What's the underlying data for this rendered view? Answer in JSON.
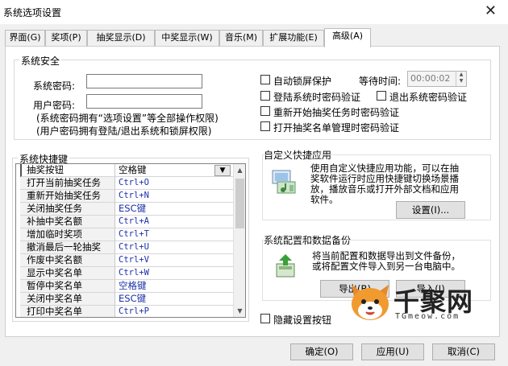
{
  "window": {
    "title": "系统选项设置"
  },
  "tabs": [
    {
      "label": "界面(G)"
    },
    {
      "label": "奖项(P)"
    },
    {
      "label": "抽奖显示(D)"
    },
    {
      "label": "中奖显示(W)"
    },
    {
      "label": "音乐(M)"
    },
    {
      "label": "扩展功能(E)"
    },
    {
      "label": "高级(A)",
      "active": true
    }
  ],
  "security": {
    "title": "系统安全",
    "system_password_label": "系统密码:",
    "system_password_value": "",
    "user_password_label": "用户密码:",
    "user_password_value": "",
    "note1": "(系统密码拥有“选项设置”等全部操作权限)",
    "note2": "(用户密码拥有登陆/退出系统和锁屏权限)",
    "auto_lock": {
      "label": "自动锁屏保护",
      "checked": false
    },
    "wait_time_label": "等待时间:",
    "wait_time_value": "00:00:02",
    "login_verify": {
      "label": "登陆系统时密码验证",
      "checked": false
    },
    "exit_verify": {
      "label": "退出系统密码验证",
      "checked": false
    },
    "restart_verify": {
      "label": "重新开始抽奖任务时密码验证",
      "checked": false
    },
    "list_verify": {
      "label": "打开抽奖名单管理时密码验证",
      "checked": false
    }
  },
  "shortcuts": {
    "title": "系统快捷键",
    "rows": [
      {
        "action": "抽奖按钮",
        "key": "空格键"
      },
      {
        "action": "打开当前抽奖任务",
        "key": "Ctrl+O"
      },
      {
        "action": "重新开始抽奖任务",
        "key": "Ctrl+N"
      },
      {
        "action": "关闭抽奖任务",
        "key": "ESC键"
      },
      {
        "action": "补抽中奖名额",
        "key": "Ctrl+A"
      },
      {
        "action": "增加临时奖项",
        "key": "Ctrl+T"
      },
      {
        "action": "撤消最后一轮抽奖",
        "key": "Ctrl+U"
      },
      {
        "action": "作废中奖名额",
        "key": "Ctrl+V"
      },
      {
        "action": "显示中奖名单",
        "key": "Ctrl+W"
      },
      {
        "action": "暂停中奖名单",
        "key": "空格键"
      },
      {
        "action": "关闭中奖名单",
        "key": "ESC键"
      },
      {
        "action": "打印中奖名单",
        "key": "Ctrl+P"
      }
    ]
  },
  "custom_app": {
    "title": "自定义快捷应用",
    "description_lines": [
      "使用自定义快捷应用功能，可以在抽",
      "奖软件运行时应用快捷键切换场景播",
      "放，播放音乐或打开外部文档和应用",
      "软件。"
    ],
    "settings_button": "设置(I)..."
  },
  "backup": {
    "title": "系统配置和数据备份",
    "description_lines": [
      "将当前配置和数据导出到文件备份，",
      "或将配置文件导入到另一台电脑中。"
    ],
    "export_button": "导出(B)",
    "import_button": "导入(I)"
  },
  "hide_settings": {
    "label": "隐藏设置按钮",
    "checked": false
  },
  "footer": {
    "ok_button": "确定(O)",
    "apply_button": "应用(U)",
    "cancel_button": "取消(C)"
  },
  "watermark": {
    "main": "千聚网",
    "sub": "TGmeow.com"
  },
  "colors": {
    "key_text": "#1a2fa8",
    "window_bg": "#f0f0f0"
  }
}
